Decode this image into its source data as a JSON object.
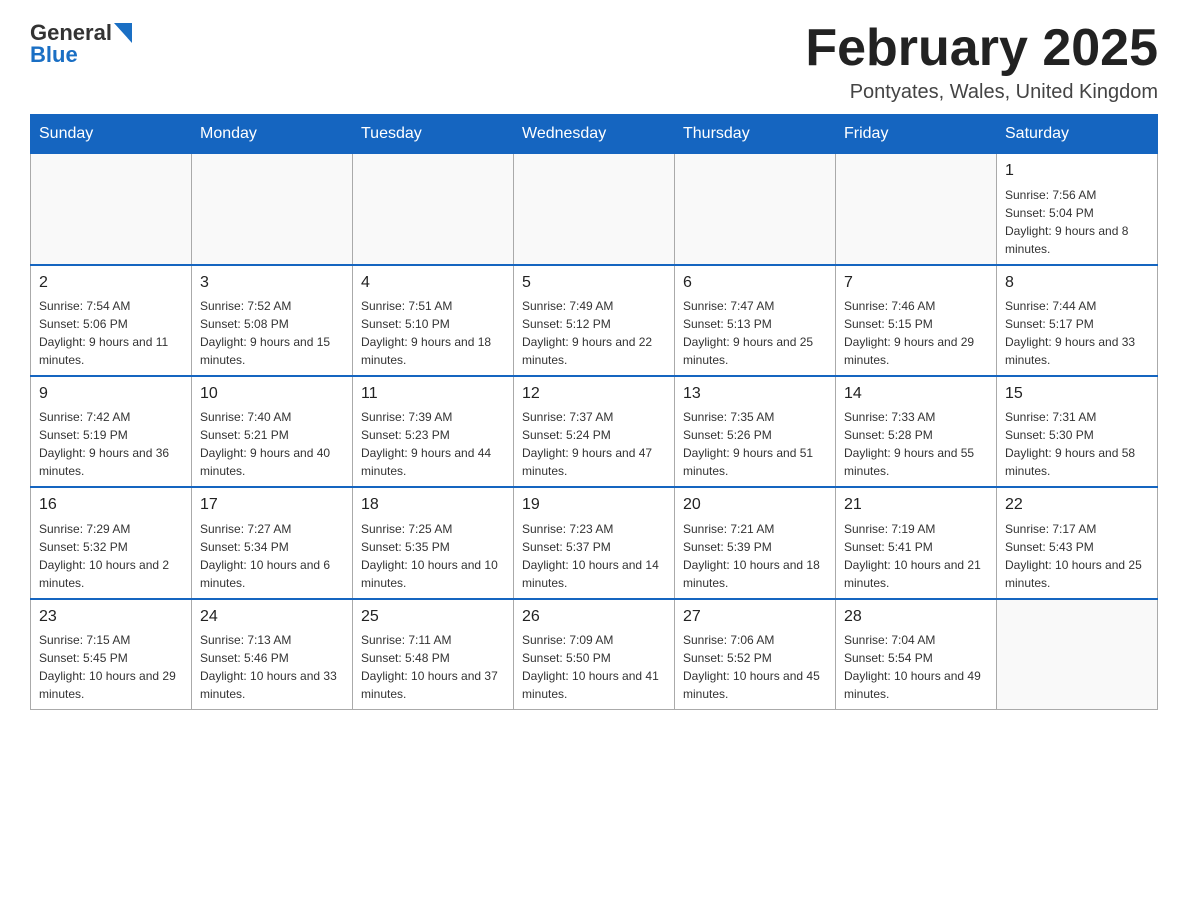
{
  "header": {
    "logo_general": "General",
    "logo_blue": "Blue",
    "month_title": "February 2025",
    "location": "Pontyates, Wales, United Kingdom"
  },
  "days_of_week": [
    "Sunday",
    "Monday",
    "Tuesday",
    "Wednesday",
    "Thursday",
    "Friday",
    "Saturday"
  ],
  "weeks": [
    [
      {
        "day": "",
        "info": ""
      },
      {
        "day": "",
        "info": ""
      },
      {
        "day": "",
        "info": ""
      },
      {
        "day": "",
        "info": ""
      },
      {
        "day": "",
        "info": ""
      },
      {
        "day": "",
        "info": ""
      },
      {
        "day": "1",
        "info": "Sunrise: 7:56 AM\nSunset: 5:04 PM\nDaylight: 9 hours and 8 minutes."
      }
    ],
    [
      {
        "day": "2",
        "info": "Sunrise: 7:54 AM\nSunset: 5:06 PM\nDaylight: 9 hours and 11 minutes."
      },
      {
        "day": "3",
        "info": "Sunrise: 7:52 AM\nSunset: 5:08 PM\nDaylight: 9 hours and 15 minutes."
      },
      {
        "day": "4",
        "info": "Sunrise: 7:51 AM\nSunset: 5:10 PM\nDaylight: 9 hours and 18 minutes."
      },
      {
        "day": "5",
        "info": "Sunrise: 7:49 AM\nSunset: 5:12 PM\nDaylight: 9 hours and 22 minutes."
      },
      {
        "day": "6",
        "info": "Sunrise: 7:47 AM\nSunset: 5:13 PM\nDaylight: 9 hours and 25 minutes."
      },
      {
        "day": "7",
        "info": "Sunrise: 7:46 AM\nSunset: 5:15 PM\nDaylight: 9 hours and 29 minutes."
      },
      {
        "day": "8",
        "info": "Sunrise: 7:44 AM\nSunset: 5:17 PM\nDaylight: 9 hours and 33 minutes."
      }
    ],
    [
      {
        "day": "9",
        "info": "Sunrise: 7:42 AM\nSunset: 5:19 PM\nDaylight: 9 hours and 36 minutes."
      },
      {
        "day": "10",
        "info": "Sunrise: 7:40 AM\nSunset: 5:21 PM\nDaylight: 9 hours and 40 minutes."
      },
      {
        "day": "11",
        "info": "Sunrise: 7:39 AM\nSunset: 5:23 PM\nDaylight: 9 hours and 44 minutes."
      },
      {
        "day": "12",
        "info": "Sunrise: 7:37 AM\nSunset: 5:24 PM\nDaylight: 9 hours and 47 minutes."
      },
      {
        "day": "13",
        "info": "Sunrise: 7:35 AM\nSunset: 5:26 PM\nDaylight: 9 hours and 51 minutes."
      },
      {
        "day": "14",
        "info": "Sunrise: 7:33 AM\nSunset: 5:28 PM\nDaylight: 9 hours and 55 minutes."
      },
      {
        "day": "15",
        "info": "Sunrise: 7:31 AM\nSunset: 5:30 PM\nDaylight: 9 hours and 58 minutes."
      }
    ],
    [
      {
        "day": "16",
        "info": "Sunrise: 7:29 AM\nSunset: 5:32 PM\nDaylight: 10 hours and 2 minutes."
      },
      {
        "day": "17",
        "info": "Sunrise: 7:27 AM\nSunset: 5:34 PM\nDaylight: 10 hours and 6 minutes."
      },
      {
        "day": "18",
        "info": "Sunrise: 7:25 AM\nSunset: 5:35 PM\nDaylight: 10 hours and 10 minutes."
      },
      {
        "day": "19",
        "info": "Sunrise: 7:23 AM\nSunset: 5:37 PM\nDaylight: 10 hours and 14 minutes."
      },
      {
        "day": "20",
        "info": "Sunrise: 7:21 AM\nSunset: 5:39 PM\nDaylight: 10 hours and 18 minutes."
      },
      {
        "day": "21",
        "info": "Sunrise: 7:19 AM\nSunset: 5:41 PM\nDaylight: 10 hours and 21 minutes."
      },
      {
        "day": "22",
        "info": "Sunrise: 7:17 AM\nSunset: 5:43 PM\nDaylight: 10 hours and 25 minutes."
      }
    ],
    [
      {
        "day": "23",
        "info": "Sunrise: 7:15 AM\nSunset: 5:45 PM\nDaylight: 10 hours and 29 minutes."
      },
      {
        "day": "24",
        "info": "Sunrise: 7:13 AM\nSunset: 5:46 PM\nDaylight: 10 hours and 33 minutes."
      },
      {
        "day": "25",
        "info": "Sunrise: 7:11 AM\nSunset: 5:48 PM\nDaylight: 10 hours and 37 minutes."
      },
      {
        "day": "26",
        "info": "Sunrise: 7:09 AM\nSunset: 5:50 PM\nDaylight: 10 hours and 41 minutes."
      },
      {
        "day": "27",
        "info": "Sunrise: 7:06 AM\nSunset: 5:52 PM\nDaylight: 10 hours and 45 minutes."
      },
      {
        "day": "28",
        "info": "Sunrise: 7:04 AM\nSunset: 5:54 PM\nDaylight: 10 hours and 49 minutes."
      },
      {
        "day": "",
        "info": ""
      }
    ]
  ]
}
